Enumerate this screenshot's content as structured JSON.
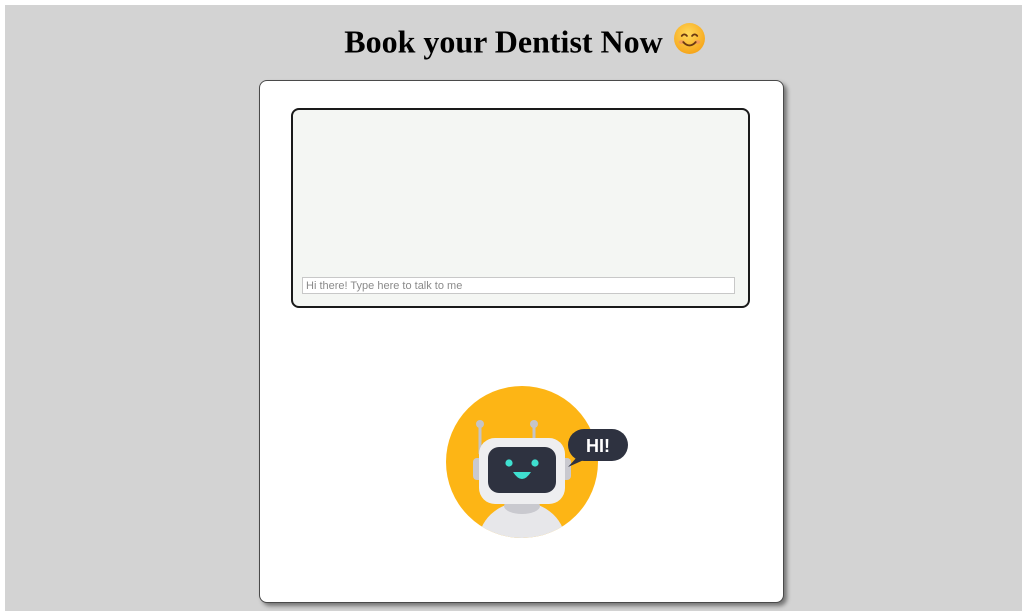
{
  "header": {
    "title": "Book your Dentist Now"
  },
  "chat": {
    "input_value": "",
    "input_placeholder": "Hi there! Type here to talk to me"
  },
  "bot": {
    "speech_bubble": "HI!"
  },
  "icons": {
    "title_emoji": "smiling-face-icon",
    "bot_avatar": "robot-icon"
  },
  "colors": {
    "page_background": "#d3d3d3",
    "card_background": "#ffffff",
    "chat_background": "#f4f6f3",
    "bot_circle": "#fdb515",
    "bot_screen": "#2e3240",
    "bot_eyes": "#3fe0d0",
    "speech_bubble": "#2e3240"
  }
}
